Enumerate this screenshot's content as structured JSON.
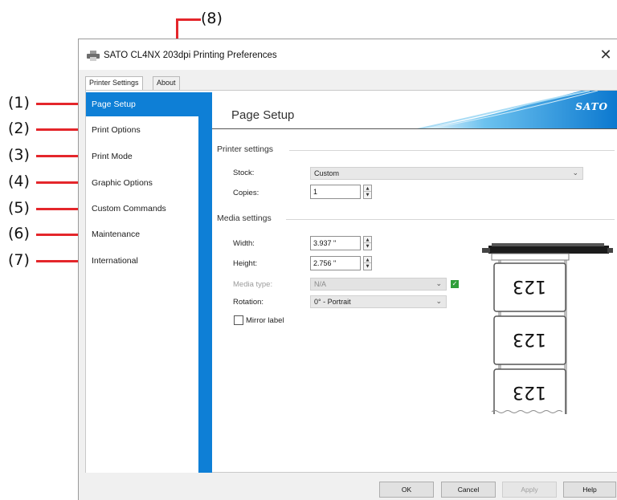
{
  "window": {
    "title": "SATO CL4NX 203dpi Printing Preferences",
    "close_symbol": "✕"
  },
  "tabs": [
    {
      "label": "Printer Settings",
      "active": true
    },
    {
      "label": "About",
      "active": false
    }
  ],
  "sidebar": {
    "items": [
      {
        "label": "Page Setup",
        "active": true
      },
      {
        "label": "Print Options"
      },
      {
        "label": "Print Mode"
      },
      {
        "label": "Graphic Options"
      },
      {
        "label": "Custom Commands"
      },
      {
        "label": "Maintenance"
      },
      {
        "label": "International"
      }
    ]
  },
  "callouts": [
    "(1)",
    "(2)",
    "(3)",
    "(4)",
    "(5)",
    "(6)",
    "(7)",
    "(8)"
  ],
  "banner": {
    "title": "Page Setup",
    "logo": "SATO"
  },
  "printer_settings": {
    "group_label": "Printer settings",
    "stock_label": "Stock:",
    "stock_value": "Custom",
    "copies_label": "Copies:",
    "copies_value": "1"
  },
  "media_settings": {
    "group_label": "Media settings",
    "width_label": "Width:",
    "width_value": "3.937 \"",
    "height_label": "Height:",
    "height_value": "2.756 \"",
    "media_type_label": "Media type:",
    "media_type_value": "N/A",
    "rotation_label": "Rotation:",
    "rotation_value": "0° - Portrait",
    "mirror_label": "Mirror label",
    "mirror_checked": false
  },
  "preview": {
    "label_text": "123"
  },
  "buttons": {
    "ok": "OK",
    "cancel": "Cancel",
    "apply": "Apply",
    "help": "Help"
  },
  "colors": {
    "accent_blue": "#0e7fd6",
    "callout_red": "#e4262b"
  }
}
